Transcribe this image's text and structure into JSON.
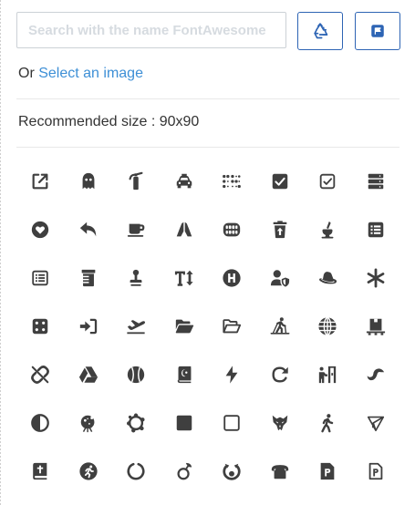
{
  "search": {
    "placeholder": "Search with the name FontAwesome"
  },
  "toolbar": {
    "recycle_icon": "recycle-icon",
    "flag_icon": "flag-icon",
    "accent_color": "#2d64b4"
  },
  "select_image": {
    "prefix": "Or",
    "link_label": "Select an image",
    "link_color": "#3d8fd6"
  },
  "recommended_size": "Recommended size : 90x90",
  "icons": [
    "external-link-icon",
    "ghost-icon",
    "fire-extinguisher-icon",
    "taxi-icon",
    "braille-icon",
    "check-square-icon",
    "check-square-outline-icon",
    "server-icon",
    "heart-circle-icon",
    "reply-icon",
    "coffee-mug-icon",
    "praying-hands-icon",
    "teeth-icon",
    "trash-restore-icon",
    "mortar-pestle-icon",
    "list-alt-icon",
    "list-alt-outline-icon",
    "prescription-bottle-icon",
    "stamp-icon",
    "text-height-icon",
    "hospital-symbol-icon",
    "user-shield-icon",
    "redhat-icon",
    "asterisk-icon",
    "dice-icon",
    "sign-in-icon",
    "plane-departure-icon",
    "folder-open-icon",
    "folder-open-outline-icon",
    "skiing-nordic-icon",
    "globe-icon",
    "pallet-boxes-icon",
    "unlink-icon",
    "google-drive-icon",
    "baseball-icon",
    "quran-icon",
    "bolt-icon",
    "redo-icon",
    "person-booth-icon",
    "pied-piper-hat-icon",
    "adjust-icon",
    "meteor-spark-icon",
    "spinner-gear-icon",
    "square-icon",
    "square-outline-icon",
    "wolf-pack-icon",
    "walking-icon",
    "telegram-plane-icon",
    "bible-icon",
    "running-circle-icon",
    "circle-notch-icon",
    "mendeley-icon",
    "deploydog-icon",
    "phone-retro-icon",
    "product-hunt-file-icon",
    "product-hunt-file-outline-icon"
  ]
}
